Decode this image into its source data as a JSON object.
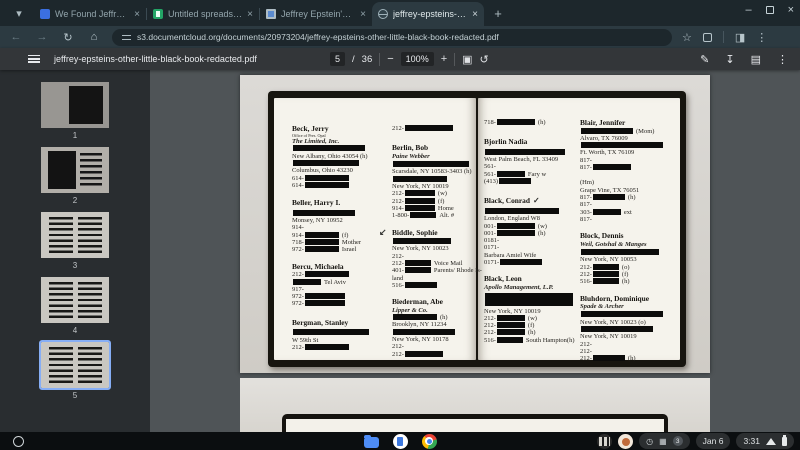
{
  "tabs": {
    "items": [
      {
        "title": "We Found Jeffrey Epstein's Oth",
        "favicon": "site-icon"
      },
      {
        "title": "Untitled spreadsheet - Google S",
        "favicon": "sheets-icon"
      },
      {
        "title": "Jeffrey Epstein's Other Little Bl",
        "favicon": "document-icon"
      },
      {
        "title": "jeffrey-epsteins-other-little-bla",
        "favicon": "globe-icon"
      }
    ]
  },
  "nav": {
    "url": "s3.documentcloud.org/documents/20973204/jeffrey-epsteins-other-little-black-book-redacted.pdf"
  },
  "pdf": {
    "filename": "jeffrey-epsteins-other-little-black-book-redacted.pdf",
    "page_current": "5",
    "page_sep": "/",
    "page_total": "36",
    "zoom_level": "100%"
  },
  "sidebar": {
    "pages": [
      {
        "label": "1"
      },
      {
        "label": "2"
      },
      {
        "label": "3"
      },
      {
        "label": "4"
      },
      {
        "label": "5"
      }
    ]
  },
  "shelf": {
    "date": "Jan 6",
    "time": "3:31",
    "badge_count": "3"
  },
  "icons": {
    "back": "←",
    "forward": "→",
    "reload": "↻",
    "home": "⌂",
    "bookmark_star": "☆",
    "side_panel": "◨",
    "menu_dots": "⋮",
    "minimize": "–",
    "close": "×",
    "tab_close": "×",
    "tab_chevron": "▾",
    "new_tab_plus": "+",
    "zoom_out": "−",
    "zoom_in": "+",
    "fit_page": "▣",
    "rotate": "↺",
    "annotate": "✎",
    "download": "↧",
    "print": "▤",
    "clock": "◷",
    "grid": "▦",
    "arrow": "↙",
    "check": "✓"
  },
  "book": {
    "left": {
      "a": [
        {
          "c": "n",
          "p": "Beck, Jerry"
        },
        {
          "c": "y",
          "p": "Office of Pres. Opal"
        },
        {
          "c": "f",
          "p": "The Limited, Inc."
        },
        {
          "b": 72
        },
        {
          "p": "New Albany, Ohio 43054 (h)"
        },
        {
          "b": 66
        },
        {
          "p": "Columbus, Ohio 43230"
        },
        {
          "p": "614-",
          "b": 44
        },
        {
          "p": "614-",
          "b": 44
        },
        {
          "c": "n",
          "p": "Beller, Harry I.",
          "m": 10
        },
        {
          "b": 62,
          "m": 2
        },
        {
          "p": "Monsey, NY 10952"
        },
        {
          "p": "914-"
        },
        {
          "p": "914-",
          "b": 34,
          "t": "(f)"
        },
        {
          "p": "718-",
          "b": 34,
          "t": "Mother"
        },
        {
          "p": "972-",
          "b": 34,
          "t": "Israel"
        },
        {
          "c": "n",
          "p": "Bercu, Michaela",
          "m": 9
        },
        {
          "p": "212-",
          "b": 44
        },
        {
          "b": 28,
          "t": "Tel Aviv"
        },
        {
          "p": "917-"
        },
        {
          "p": "972-",
          "b": 40
        },
        {
          "p": "972-",
          "b": 40
        },
        {
          "c": "n",
          "p": "Bergman, Stanley",
          "m": 11
        },
        {
          "b": 76,
          "m": 2
        },
        {
          "p": "W 59th St"
        },
        {
          "p": "212-",
          "b": 44
        }
      ],
      "b": [
        {
          "p": "212-",
          "b": 48
        },
        {
          "c": "n",
          "p": "Berlin, Bob",
          "m": 12
        },
        {
          "c": "f",
          "p": "Paine Webber"
        },
        {
          "b": 76,
          "m": 1
        },
        {
          "p": "Scarsdale, NY 10583-3403 (h)"
        },
        {
          "b": 54
        },
        {
          "p": "New York, NY 10019"
        },
        {
          "p": "212-",
          "b": 30,
          "t": "(w)"
        },
        {
          "p": "212-",
          "b": 30,
          "t": "(f)"
        },
        {
          "p": "914-",
          "b": 30,
          "t": "Home"
        },
        {
          "p": "1-800-",
          "b": 26,
          "t": "Alt. #"
        },
        {
          "c": "n",
          "p": "Biddle, Sophie",
          "m": 9,
          "arrow": true
        },
        {
          "b": 58,
          "m": 1
        },
        {
          "p": "New York, NY 10023"
        },
        {
          "p": "212-"
        },
        {
          "p": "212-",
          "b": 26,
          "t": "Voice Mail"
        },
        {
          "p": "401-",
          "b": 26,
          "t": "Parents/ Rhode Is-"
        },
        {
          "p": "land"
        },
        {
          "p": "516-",
          "b": 32
        },
        {
          "c": "n",
          "p": "Biederman, Abe",
          "m": 9
        },
        {
          "c": "f",
          "p": "Lipper & Co."
        },
        {
          "b": 44,
          "t": "(h)"
        },
        {
          "p": "Brooklyn, NY 11234"
        },
        {
          "b": 62
        },
        {
          "p": "New York, NY 10178"
        },
        {
          "p": "212-"
        },
        {
          "p": "212-",
          "b": 38
        }
      ]
    },
    "right": {
      "a": [
        {
          "p": "718-",
          "b": 38,
          "t": "(h)"
        },
        {
          "c": "n",
          "p": "Bjorlin Nadia",
          "m": 12
        },
        {
          "b": 80,
          "m": 2
        },
        {
          "p": "West Palm Beach, FL 33409"
        },
        {
          "p": "561-"
        },
        {
          "p": "561-",
          "b": 28,
          "t": "Fary w"
        },
        {
          "p": "(413)",
          "b": 32
        },
        {
          "c": "n",
          "p": "Black, Conrad",
          "m": 12,
          "check": true
        },
        {
          "b": 74,
          "m": 2
        },
        {
          "p": "London, England W8"
        },
        {
          "p": "001-",
          "b": 38,
          "t": "(w)"
        },
        {
          "p": "001-",
          "b": 38,
          "t": "(h)"
        },
        {
          "p": "0181-"
        },
        {
          "p": "0171-"
        },
        {
          "p": "Barbara Amiel Wife"
        },
        {
          "p": "0171-",
          "b": 42
        },
        {
          "c": "n",
          "p": "Black, Leon",
          "m": 9
        },
        {
          "c": "f",
          "p": "Apollo Management, L.P."
        },
        {
          "b": 88,
          "h": 13,
          "m": 2
        },
        {
          "p": "New York, NY 10019"
        },
        {
          "p": "212-",
          "b": 28,
          "t": "(w)"
        },
        {
          "p": "212-",
          "b": 28,
          "t": "(f)"
        },
        {
          "p": "212-",
          "b": 28,
          "t": "(h)"
        },
        {
          "p": "516-",
          "b": 26,
          "t": "South Hampton(h)"
        }
      ],
      "b": [
        {
          "c": "n",
          "p": "Blair, Jennifer"
        },
        {
          "b": 52,
          "t": "(Mom)"
        },
        {
          "p": "Alvaro, TX 76009"
        },
        {
          "b": 82
        },
        {
          "p": "Ft. Worth, TX 76109"
        },
        {
          "p": "817-"
        },
        {
          "p": "817-",
          "b": 38
        },
        {
          "p": "(Hm)",
          "m": 8
        },
        {
          "p": "Grape Vine, TX 76051"
        },
        {
          "p": "817-",
          "b": 32,
          "t": "(h)"
        },
        {
          "p": "817-"
        },
        {
          "p": "303-",
          "b": 28,
          "t": "ext"
        },
        {
          "p": "817-"
        },
        {
          "c": "n",
          "p": "Block, Dennis",
          "m": 9
        },
        {
          "c": "f",
          "p": "Weil, Gotshal & Manges"
        },
        {
          "b": 78,
          "m": 1
        },
        {
          "p": "New York, NY 10053"
        },
        {
          "p": "212-",
          "b": 26,
          "t": "(o)"
        },
        {
          "p": "212-",
          "b": 26,
          "t": "(f)"
        },
        {
          "p": "516-",
          "b": 26,
          "t": "(h)"
        },
        {
          "c": "n",
          "p": "Bluhdorn, Dominique",
          "m": 9
        },
        {
          "c": "f",
          "p": "Spade & Archer"
        },
        {
          "b": 82,
          "m": 1
        },
        {
          "p": "New York, NY 10023 (o)"
        },
        {
          "b": 72
        },
        {
          "p": "New York, NY 10019"
        },
        {
          "p": "212-"
        },
        {
          "p": "212-"
        },
        {
          "p": "212-",
          "b": 32,
          "t": "(h)"
        }
      ]
    }
  }
}
